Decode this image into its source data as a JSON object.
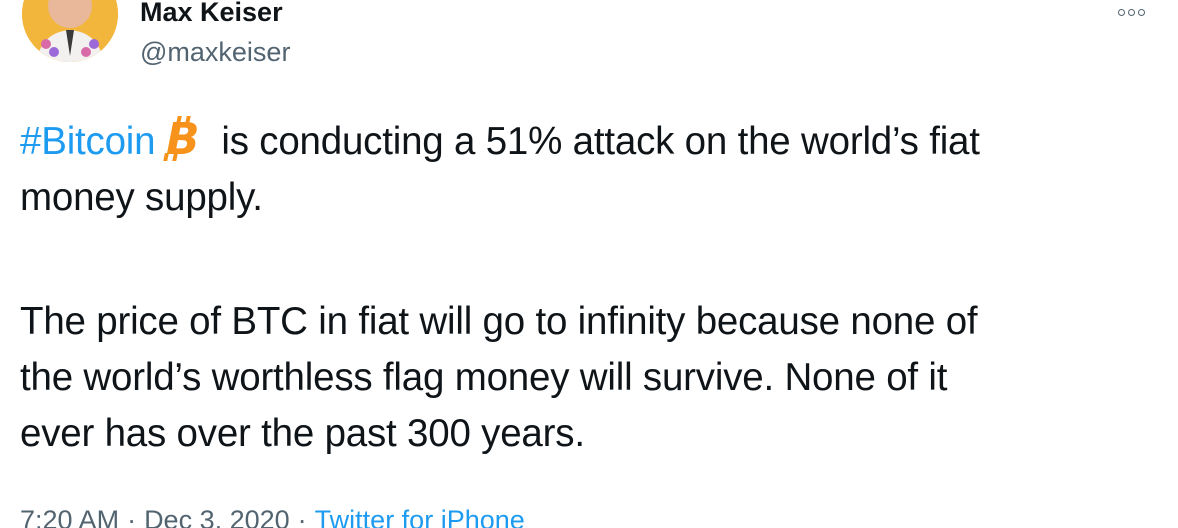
{
  "author": {
    "display_name": "Max Keiser",
    "handle": "@maxkeiser",
    "avatar_icon": "profile-photo"
  },
  "menu": {
    "more_icon": "more-horizontal-icon"
  },
  "tweet": {
    "hashtag": "#Bitcoin",
    "emoji_icon": "bitcoin-b-icon",
    "line1_rest": "is conducting a 51% attack on the world’s fiat",
    "line2": "money supply.",
    "paragraph2_line1": "The price of BTC in fiat will go to infinity because none of",
    "paragraph2_line2": "the world’s worthless flag money will survive. None of it",
    "paragraph2_line3": "ever has over the past 300 years."
  },
  "meta": {
    "time": "7:20 AM",
    "separator": "·",
    "date": "Dec 3, 2020",
    "source": "Twitter for iPhone"
  },
  "colors": {
    "link": "#1d9bf0",
    "secondary_text": "#536471",
    "primary_text": "#0f1419",
    "bitcoin_orange": "#f7931a"
  }
}
